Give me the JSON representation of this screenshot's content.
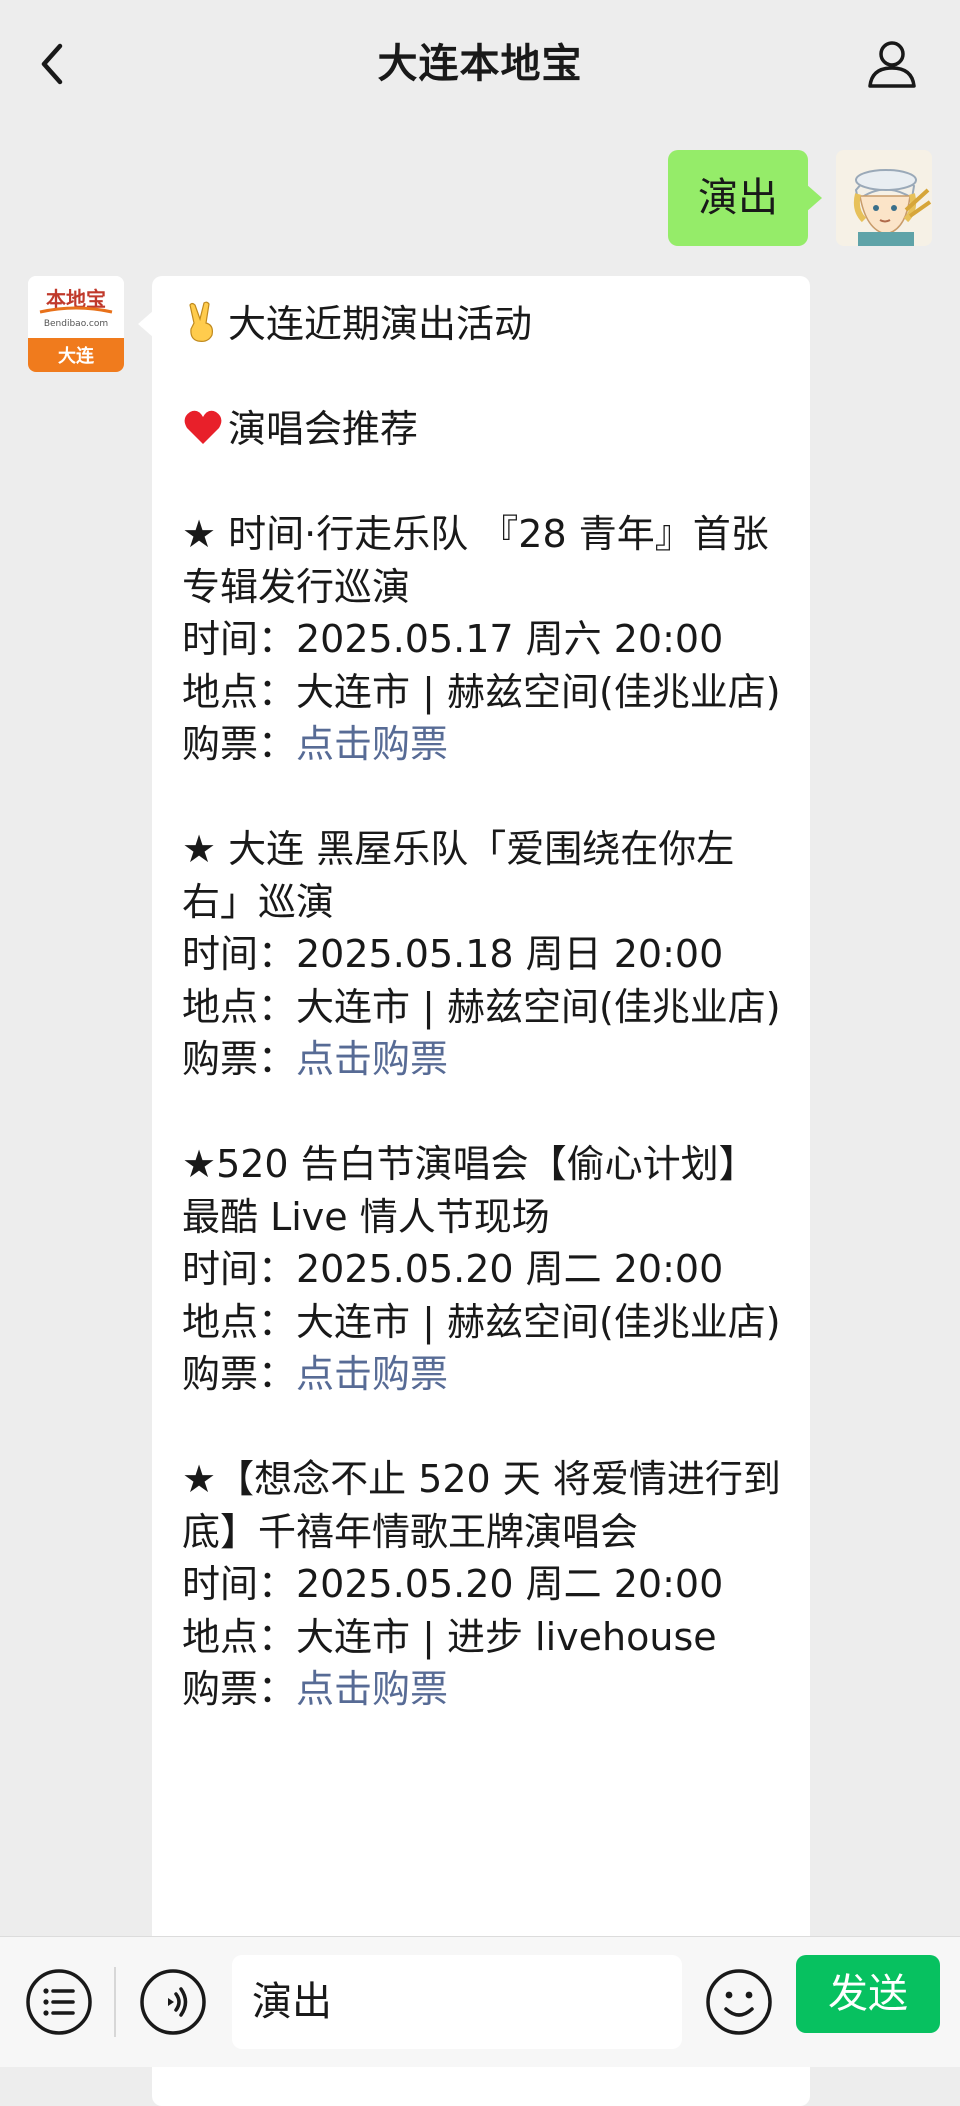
{
  "header": {
    "title": "大连本地宝"
  },
  "user_message": {
    "text": "演出"
  },
  "oa_avatar": {
    "logo_top": "本地宝",
    "logo_url": "Bendibao.com",
    "logo_city": "大连"
  },
  "reply": {
    "intro": "大连近期演出活动",
    "section": "演唱会推荐",
    "events": [
      {
        "title": "★ 时间·行走乐队 『28 青年』首张专辑发行巡演",
        "time": "时间：2025.05.17 周六 20:00",
        "place": "地点：大连市 | 赫兹空间(佳兆业店)",
        "ticket_label": "购票：",
        "ticket_link": "点击购票"
      },
      {
        "title": "★ 大连 黑屋乐队「爱围绕在你左右」巡演",
        "time": "时间：2025.05.18 周日 20:00",
        "place": "地点：大连市 | 赫兹空间(佳兆业店)",
        "ticket_label": "购票：",
        "ticket_link": "点击购票"
      },
      {
        "title": "★520 告白节演唱会【偷心计划】最酷 Live 情人节现场",
        "time": "时间：2025.05.20 周二 20:00",
        "place": "地点：大连市 | 赫兹空间(佳兆业店)",
        "ticket_label": "购票：",
        "ticket_link": "点击购票"
      },
      {
        "title": "★【想念不止 520 天 将爱情进行到底】千禧年情歌王牌演唱会",
        "time": "时间：2025.05.20 周二 20:00",
        "place": "地点：大连市 | 进步 livehouse",
        "ticket_label": "购票：",
        "ticket_link": "点击购票"
      }
    ]
  },
  "input_bar": {
    "value": "演出",
    "send_label": "发送"
  },
  "colors": {
    "background": "#ededed",
    "user_bubble": "#95ec69",
    "link": "#576b95",
    "send_button": "#07c160"
  },
  "icons": [
    "back-arrow-icon",
    "profile-icon",
    "peace-emoji-icon",
    "heart-emoji-icon",
    "menu-list-icon",
    "voice-icon",
    "emoji-smile-icon"
  ]
}
